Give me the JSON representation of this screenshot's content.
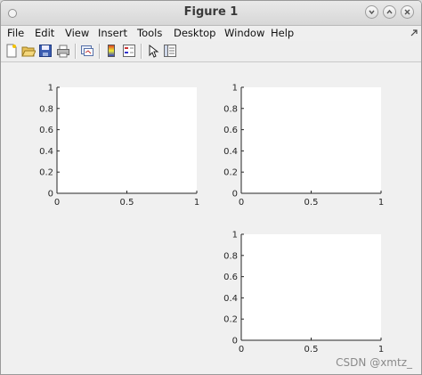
{
  "window": {
    "title": "Figure 1"
  },
  "menu": [
    "File",
    "Edit",
    "View",
    "Insert",
    "Tools",
    "Desktop",
    "Window",
    "Help"
  ],
  "toolbar": {
    "tools": [
      "new-figure-icon",
      "open-folder-icon",
      "save-icon",
      "print-icon",
      "link-figure-icon",
      "colorbar-icon",
      "legend-icon",
      "pointer-arrow-icon",
      "property-editor-icon"
    ]
  },
  "chart_data": [
    {
      "type": "line",
      "series": [],
      "xlim": [
        0,
        1
      ],
      "ylim": [
        0,
        1
      ],
      "xticks": [
        "0",
        "0.5",
        "1"
      ],
      "yticks": [
        "0",
        "0.2",
        "0.4",
        "0.6",
        "0.8",
        "1"
      ]
    },
    {
      "type": "line",
      "series": [],
      "xlim": [
        0,
        1
      ],
      "ylim": [
        0,
        1
      ],
      "xticks": [
        "0",
        "0.5",
        "1"
      ],
      "yticks": [
        "0",
        "0.2",
        "0.4",
        "0.6",
        "0.8",
        "1"
      ]
    },
    {
      "type": "line",
      "series": [],
      "xlim": [
        0,
        1
      ],
      "ylim": [
        0,
        1
      ],
      "xticks": [
        "0",
        "0.5",
        "1"
      ],
      "yticks": [
        "0",
        "0.2",
        "0.4",
        "0.6",
        "0.8",
        "1"
      ]
    }
  ],
  "watermark": "CSDN @xmtz_"
}
